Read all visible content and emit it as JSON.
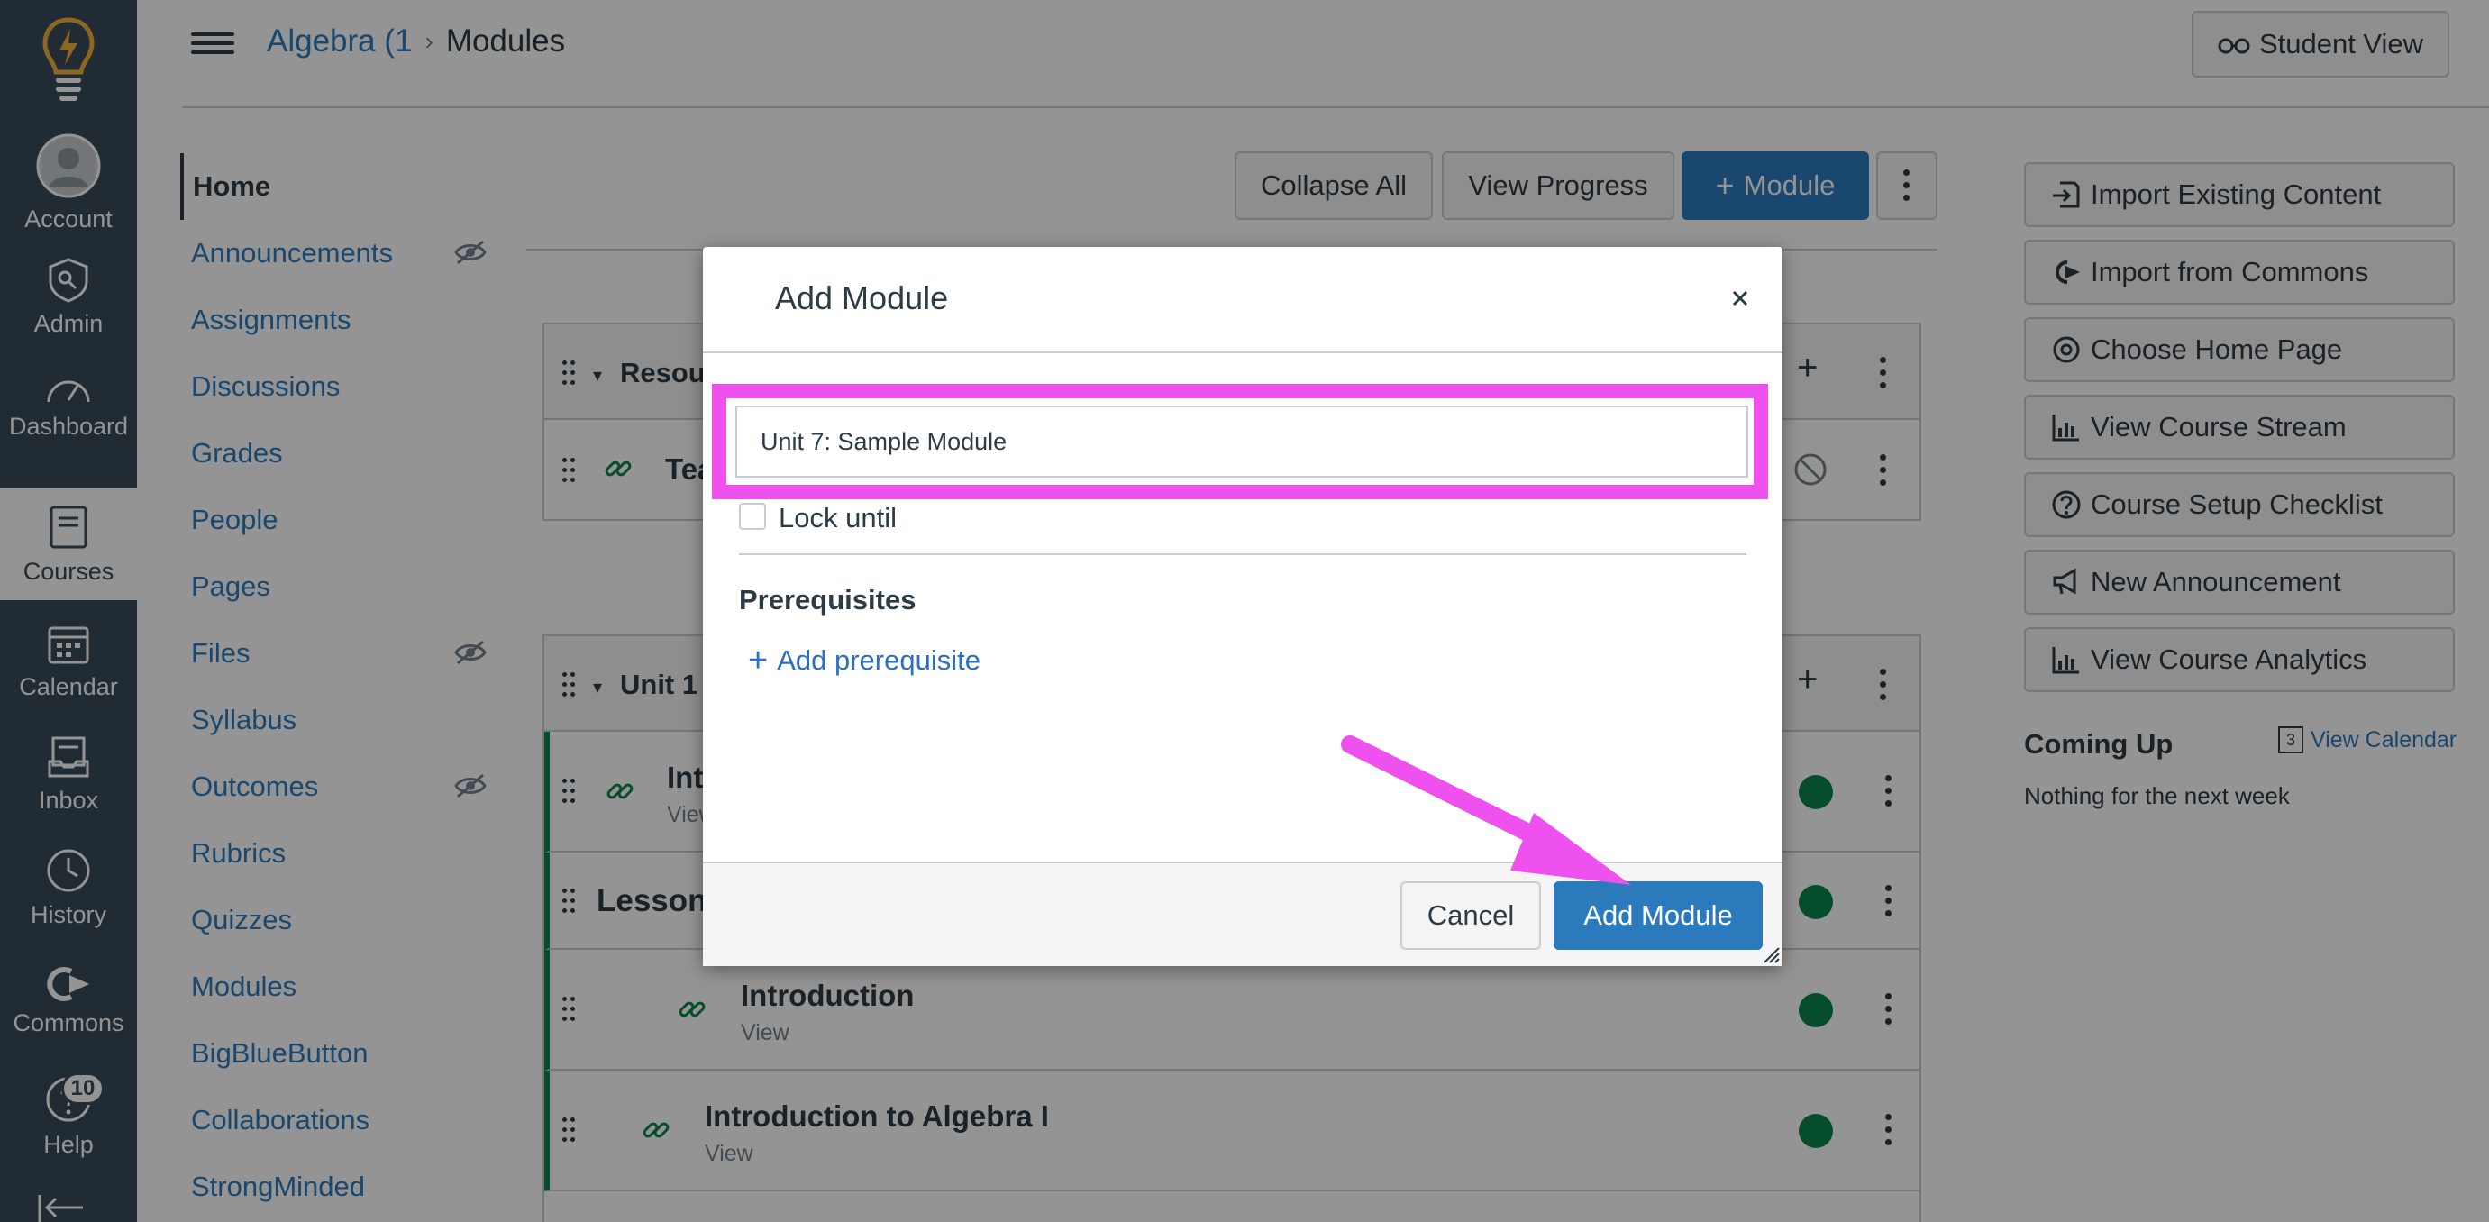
{
  "global_nav": {
    "items": [
      {
        "label": "Account",
        "icon": "account-icon"
      },
      {
        "label": "Admin",
        "icon": "admin-icon"
      },
      {
        "label": "Dashboard",
        "icon": "dashboard-icon"
      },
      {
        "label": "Courses",
        "icon": "courses-icon",
        "active": true
      },
      {
        "label": "Calendar",
        "icon": "calendar-icon"
      },
      {
        "label": "Inbox",
        "icon": "inbox-icon"
      },
      {
        "label": "History",
        "icon": "history-icon"
      },
      {
        "label": "Commons",
        "icon": "commons-icon"
      },
      {
        "label": "Help",
        "icon": "help-icon",
        "badge": "10"
      }
    ]
  },
  "header": {
    "course_crumb": "Algebra (1",
    "current_crumb": "Modules",
    "student_view": "Student View"
  },
  "course_nav": [
    {
      "label": "Home",
      "active": true
    },
    {
      "label": "Announcements",
      "hidden": true
    },
    {
      "label": "Assignments"
    },
    {
      "label": "Discussions"
    },
    {
      "label": "Grades"
    },
    {
      "label": "People"
    },
    {
      "label": "Pages"
    },
    {
      "label": "Files",
      "hidden": true
    },
    {
      "label": "Syllabus"
    },
    {
      "label": "Outcomes",
      "hidden": true
    },
    {
      "label": "Rubrics"
    },
    {
      "label": "Quizzes"
    },
    {
      "label": "Modules"
    },
    {
      "label": "BigBlueButton"
    },
    {
      "label": "Collaborations"
    },
    {
      "label": "StrongMinded"
    }
  ],
  "toolbar": {
    "collapse_all": "Collapse All",
    "view_progress": "View Progress",
    "add_module": "Module"
  },
  "modules": {
    "module1_title": "Resour",
    "module1_row": "Tea",
    "module2_title": "Unit 1",
    "rows": [
      {
        "title": "Int",
        "sub": "View"
      },
      {
        "title": "Lesson"
      },
      {
        "title": "Introduction",
        "sub": "View"
      },
      {
        "title": "Introduction to Algebra I",
        "sub": "View"
      }
    ]
  },
  "sidebar": {
    "buttons": [
      {
        "label": "Import Existing Content",
        "icon": "import-icon"
      },
      {
        "label": "Import from Commons",
        "icon": "commons-icon"
      },
      {
        "label": "Choose Home Page",
        "icon": "target-icon"
      },
      {
        "label": "View Course Stream",
        "icon": "stream-icon"
      },
      {
        "label": "Course Setup Checklist",
        "icon": "question-icon"
      },
      {
        "label": "New Announcement",
        "icon": "megaphone-icon"
      },
      {
        "label": "View Course Analytics",
        "icon": "analytics-icon"
      }
    ],
    "coming_up": "Coming Up",
    "view_calendar": "View Calendar",
    "calendar_day": "3",
    "nothing": "Nothing for the next week"
  },
  "dialog": {
    "title": "Add Module",
    "module_name_value": "Unit 7: Sample Module",
    "lock_until": "Lock until",
    "prerequisites": "Prerequisites",
    "add_prerequisite": "Add prerequisite",
    "cancel": "Cancel",
    "submit": "Add Module"
  },
  "colors": {
    "nav_bg": "#394b58",
    "brand_blue": "#2b7abc",
    "highlight_magenta": "#ef51ef",
    "success_green": "#0b874b"
  }
}
